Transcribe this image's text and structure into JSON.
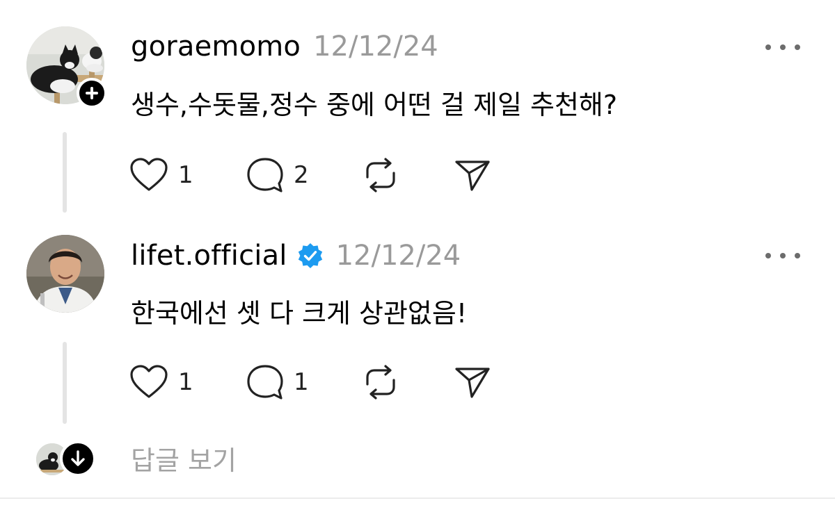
{
  "posts": [
    {
      "username": "goraemomo",
      "timestamp": "12/12/24",
      "text": "생수,수돗물,정수 중에 어떤 걸 제일 추천해?",
      "likes": "1",
      "comments": "2",
      "verified": false,
      "avatar_icon": "cat-photo",
      "badge_icon": "plus-icon"
    },
    {
      "username": "lifet.official",
      "timestamp": "12/12/24",
      "text": "한국에선 셋 다 크게 상관없음!",
      "likes": "1",
      "comments": "1",
      "verified": true,
      "avatar_icon": "doctor-photo"
    }
  ],
  "replies": {
    "label": "답글 보기"
  },
  "colors": {
    "text": "#000000",
    "muted": "#9a9a9a",
    "verified": "#1d9bf0",
    "thread_line": "#e4e4e4",
    "divider": "#ececec"
  }
}
